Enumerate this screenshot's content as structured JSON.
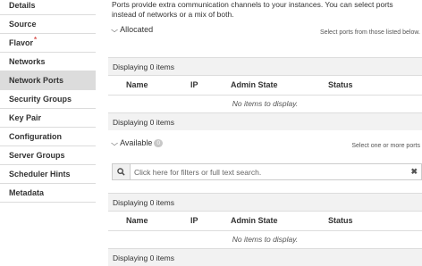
{
  "sidebar": {
    "items": [
      {
        "label": "Details"
      },
      {
        "label": "Source"
      },
      {
        "label": "Flavor",
        "required": "*"
      },
      {
        "label": "Networks"
      },
      {
        "label": "Network Ports"
      },
      {
        "label": "Security Groups"
      },
      {
        "label": "Key Pair"
      },
      {
        "label": "Configuration"
      },
      {
        "label": "Server Groups"
      },
      {
        "label": "Scheduler Hints"
      },
      {
        "label": "Metadata"
      }
    ],
    "active": "Network Ports"
  },
  "main": {
    "description": "Ports provide extra communication channels to your instances. You can select ports instead of networks or a mix of both.",
    "allocated": {
      "title": "Allocated",
      "hint": "Select ports from those listed below.",
      "count_top": "Displaying 0 items",
      "columns": [
        "Name",
        "IP",
        "Admin State",
        "Status"
      ],
      "empty": "No items to display.",
      "count_bottom": "Displaying 0 items"
    },
    "available": {
      "title": "Available",
      "badge": "0",
      "hint": "Select one or more ports",
      "search_placeholder": "Click here for filters or full text search.",
      "count_top": "Displaying 0 items",
      "columns": [
        "Name",
        "IP",
        "Admin State",
        "Status"
      ],
      "empty": "No items to display.",
      "count_bottom": "Displaying 0 items"
    }
  },
  "icons": {
    "chevron": "chevron-down-icon",
    "search": "search-icon",
    "clear": "close-icon"
  }
}
